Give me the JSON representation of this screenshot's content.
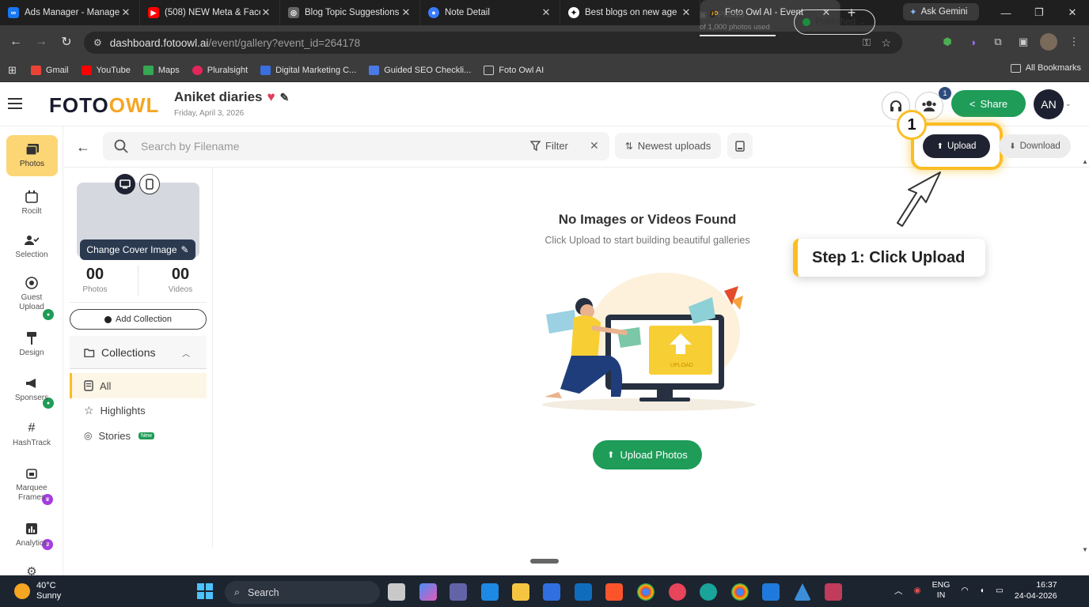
{
  "browser": {
    "tabs": [
      {
        "title": "Ads Manager - Manage",
        "icon": "meta-icon",
        "color": "#1877f2"
      },
      {
        "title": "(508) NEW Meta & Face",
        "icon": "youtube-icon",
        "color": "#ff0000"
      },
      {
        "title": "Blog Topic Suggestions",
        "icon": "chatgpt-icon",
        "color": "#888888"
      },
      {
        "title": "Note Detail",
        "icon": "note-icon",
        "color": "#3a7bfd"
      },
      {
        "title": "Best blogs on new age",
        "icon": "ai-icon",
        "color": "#ffffff"
      },
      {
        "title": "Foto Owl AI - Event",
        "icon": "fotoowl-icon",
        "color": "#f5a623",
        "active": true
      }
    ],
    "gemini_label": "Ask Gemini",
    "url_main": "dashboard.fotoowl.ai",
    "url_path": "/event/gallery?event_id=264178",
    "bookmarks": [
      {
        "label": "Gmail",
        "color": "#ea4335"
      },
      {
        "label": "YouTube",
        "color": "#ff0000"
      },
      {
        "label": "Maps",
        "color": "#34a853"
      },
      {
        "label": "Pluralsight",
        "color": "#e5265a"
      },
      {
        "label": "Digital Marketing C...",
        "color": "#3b6fe0"
      },
      {
        "label": "Guided SEO Checkli...",
        "color": "#4a7ae8"
      },
      {
        "label": "Foto Owl AI",
        "color": "#9e9e9e"
      }
    ],
    "all_bookmarks": "All Bookmarks"
  },
  "header": {
    "logo_left": "FOTO",
    "logo_right": "OWL",
    "event_name": "Aniket diaries",
    "event_date": "Friday, April 3, 2026",
    "photo_count": "0",
    "photo_label": "Photos",
    "quota": "of 1,000 photos used",
    "status": "Published",
    "guests_badge": "1",
    "share": "Share",
    "avatar": "AN"
  },
  "rail": [
    {
      "label": "Photos",
      "icon": "photos-icon",
      "active": true
    },
    {
      "label": "Rocilt",
      "icon": "calendar-icon",
      "badge": "green"
    },
    {
      "label": "Selection",
      "icon": "selection-icon"
    },
    {
      "label": "Guest Upload",
      "icon": "guest-upload-icon",
      "badge": "green"
    },
    {
      "label": "Design",
      "icon": "design-icon"
    },
    {
      "label": "Sponsers",
      "icon": "megaphone-icon",
      "badge": "purple"
    },
    {
      "label": "HashTrack",
      "icon": "hash-icon",
      "badge": "purple"
    },
    {
      "label": "Marquee Frames",
      "icon": "frames-icon",
      "badge": "purple"
    },
    {
      "label": "Analytics",
      "icon": "analytics-icon"
    }
  ],
  "toolbar": {
    "search_placeholder": "Search by Filename",
    "filter": "Filter",
    "sort": "Newest uploads",
    "upload": "Upload",
    "download": "Download"
  },
  "panel": {
    "change_cover": "Change Cover Image",
    "photos_count": "00",
    "photos_label": "Photos",
    "videos_count": "00",
    "videos_label": "Videos",
    "add_collection": "Add Collection",
    "collections_title": "Collections",
    "collections": [
      {
        "label": "All",
        "selected": true
      },
      {
        "label": "Highlights"
      },
      {
        "label": "Stories",
        "tag": "New"
      }
    ]
  },
  "main": {
    "empty_title": "No Images or Videos Found",
    "empty_sub": "Click Upload to start building beautiful galleries",
    "illustration_text": "UPLOAD",
    "upload_photos": "Upload Photos"
  },
  "tutorial": {
    "step_number": "1",
    "callout": "Step 1: Click Upload"
  },
  "taskbar": {
    "temp": "40°C",
    "weather": "Sunny",
    "search": "Search",
    "lang1": "ENG",
    "lang2": "IN",
    "time": "16:37",
    "date": "24-04-2026"
  }
}
